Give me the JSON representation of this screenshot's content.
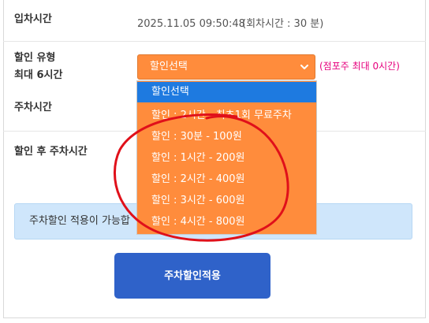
{
  "rows": {
    "entry_time": {
      "label": "입차시간",
      "value": "2025.11.05 09:50:48",
      "note": "(회차시간 : 30 분)"
    },
    "discount_type": {
      "label_line1": "할인 유형",
      "label_line2": "최대 6시간",
      "selected": "할인선택",
      "note": "(점포주 최대 0시간)"
    },
    "parking_time": {
      "label": "주차시간"
    },
    "after_discount": {
      "label": "할인 후 주차시간"
    }
  },
  "dropdown": {
    "options": [
      "할인선택",
      "할인 : 2시간 - 최초1회 무료주차",
      "할인 : 30분 - 100원",
      "할인 : 1시간 - 200원",
      "할인 : 2시간 - 400원",
      "할인 : 3시간 - 600원",
      "할인 : 4시간 - 800원"
    ]
  },
  "info_message": "주차할인 적용이 가능합",
  "apply_button": "주차할인적용",
  "colors": {
    "select_bg": "#ff8c3c",
    "selected_option": "#1e7ae0",
    "note_pink": "#e6007e",
    "button_blue": "#2f62c9",
    "annotation_red": "#e0101a"
  }
}
